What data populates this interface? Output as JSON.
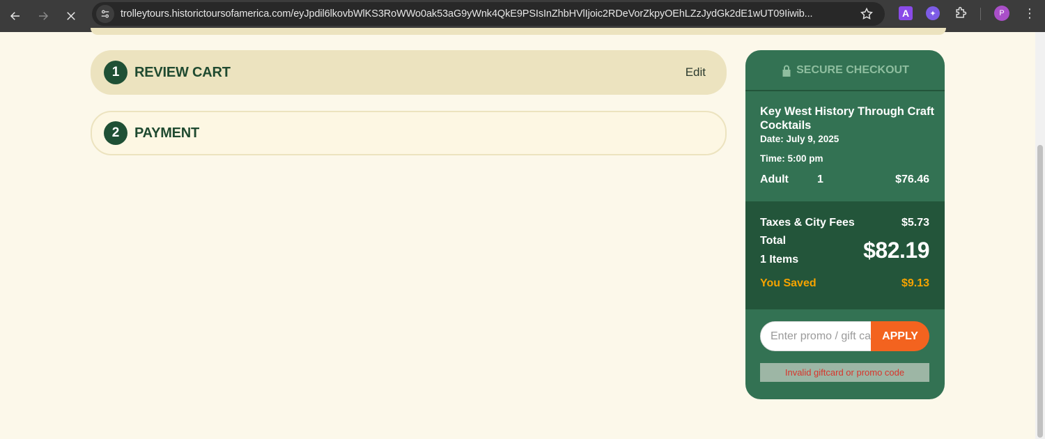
{
  "browser": {
    "url": "trolleytours.historictoursofamerica.com/eyJpdil6lkovbWlKS3RoWWo0ak53aG9yWnk4QkE9PSIsInZhbHVlIjoic2RDeVorZkpyOEhLZzJydGk2dE1wUT09Iiwib...",
    "ext_a_label": "A",
    "profile_initial": "P"
  },
  "checkout": {
    "steps": [
      {
        "number": "1",
        "title": "REVIEW CART",
        "action": "Edit"
      },
      {
        "number": "2",
        "title": "PAYMENT"
      }
    ]
  },
  "summary": {
    "header": "SECURE CHECKOUT",
    "tour_name": "Key West History Through Craft Cocktails",
    "date": "Date: July 9, 2025",
    "time": "Time: 5:00 pm",
    "line_item": {
      "label": "Adult",
      "qty": "1",
      "price": "$76.46"
    },
    "taxes_label": "Taxes & City Fees",
    "taxes_value": "$5.73",
    "total_label": "Total",
    "items_label": "1 Items",
    "total_value": "$82.19",
    "saved_label": "You Saved",
    "saved_value": "$9.13",
    "promo_placeholder": "Enter promo / gift card",
    "apply_label": "APPLY",
    "error_text": "Invalid giftcard or promo code"
  },
  "colors": {
    "page_bg": "#fcf8ea",
    "card_green": "#337253",
    "card_dark": "#23553a",
    "step_bg": "#ece3bf",
    "accent_orange": "#f3631f",
    "saved_gold": "#f5a300"
  }
}
